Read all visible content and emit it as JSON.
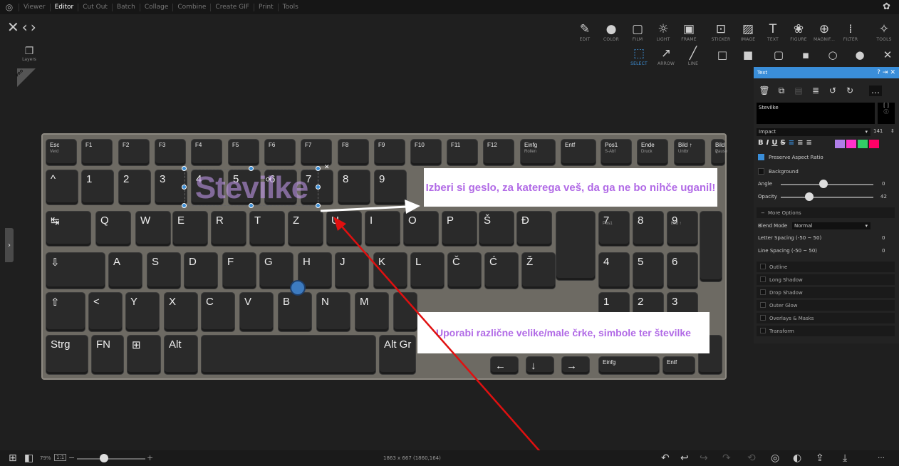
{
  "menu": {
    "items": [
      "Viewer",
      "Editor",
      "Cut Out",
      "Batch",
      "Collage",
      "Combine",
      "Create GIF",
      "Print",
      "Tools"
    ],
    "active_index": 1
  },
  "toolbar": {
    "tools": [
      {
        "label": "EDIT",
        "icon": "edit-icon"
      },
      {
        "label": "COLOR",
        "icon": "color-icon"
      },
      {
        "label": "FILM",
        "icon": "film-icon"
      },
      {
        "label": "LIGHT",
        "icon": "light-icon"
      },
      {
        "label": "FRAME",
        "icon": "frame-icon"
      },
      {
        "label": "STICKER",
        "icon": "sticker-icon"
      },
      {
        "label": "IMAGE",
        "icon": "image-icon"
      },
      {
        "label": "TEXT",
        "icon": "text-icon"
      },
      {
        "label": "FIGURE",
        "icon": "figure-icon"
      },
      {
        "label": "MAGNIF...",
        "icon": "magnifier-icon"
      },
      {
        "label": "FILTER",
        "icon": "filter-icon"
      },
      {
        "label": "TOOLS",
        "icon": "tools-icon"
      }
    ],
    "sub_tools": [
      {
        "label": "SELECT",
        "icon": "select-icon",
        "selected": true
      },
      {
        "label": "ARROW",
        "icon": "arrow-icon"
      },
      {
        "label": "LINE",
        "icon": "line-icon"
      }
    ]
  },
  "left": {
    "layers_label": "Layers",
    "pro_badge": "PRO"
  },
  "canvas": {
    "text_layer": "Stevilke",
    "banner_top": "Izberi si geslo, za katerega veš, da ga ne bo nihče uganil!",
    "banner_bottom": "Uporabi različne velike/male črke, simbole ter številke",
    "keys_row1": [
      "Esc",
      "F1",
      "F2",
      "F3",
      "F4",
      "F5",
      "F6",
      "F7",
      "F8",
      "F9",
      "F10",
      "F11",
      "F12",
      "Einfg",
      "Entf",
      "Pos1",
      "Ende",
      "Bild ↑",
      "Bild ↓"
    ],
    "keys_row1_sub": [
      "Verd",
      "",
      "",
      "",
      "",
      "",
      "",
      "",
      "",
      "",
      "",
      "",
      "",
      "Rollen",
      "",
      "S-Abf",
      "Druck",
      "Untbr",
      "Pause"
    ],
    "keys_row2": [
      "^",
      "1",
      "2",
      "3",
      "4",
      "5",
      "6",
      "7",
      "8",
      "9"
    ],
    "keys_row3": [
      "Q",
      "W",
      "E",
      "R",
      "T",
      "Z",
      "U",
      "I",
      "O",
      "P",
      "Š",
      "Đ"
    ],
    "keys_row3_num": [
      "7",
      "8",
      "9"
    ],
    "keys_row3_num_sub": [
      "Pos1",
      "↑",
      "Bild ↑"
    ],
    "keys_row4": [
      "A",
      "S",
      "D",
      "F",
      "G",
      "H",
      "J",
      "K",
      "L",
      "Č",
      "Ć",
      "Ž"
    ],
    "keys_row4_num": [
      "4",
      "5",
      "6"
    ],
    "keys_row5": [
      "Y",
      "X",
      "C",
      "V",
      "B",
      "N",
      "M"
    ],
    "keys_row5_num": [
      "1",
      "2",
      "3"
    ],
    "keys_row6": [
      "Strg",
      "FN",
      "Alt",
      "Alt Gr",
      "Einfg",
      "Entf"
    ]
  },
  "panel": {
    "title": "Text",
    "text_value": "Stevilke",
    "font": "Impact",
    "font_size": "141",
    "preserve_aspect": "Preserve Aspect Ratio",
    "background": "Background",
    "angle_label": "Angle",
    "angle_value": "0",
    "opacity_label": "Opacity",
    "opacity_value": "42",
    "more_options": "More Options",
    "blend_label": "Blend Mode",
    "blend_value": "Normal",
    "letter_spacing": "Letter Spacing (-50 ~ 50)",
    "letter_spacing_value": "0",
    "line_spacing": "Line Spacing (-50 ~ 50)",
    "line_spacing_value": "0",
    "sections": [
      "Outline",
      "Long Shadow",
      "Drop Shadow",
      "Outer Glow",
      "Overlays & Masks",
      "Transform"
    ],
    "colors": [
      "#b07ee8",
      "#ff33cc",
      "#33cc66",
      "#ff0066"
    ]
  },
  "bottom": {
    "zoom": "79%",
    "ratio": "1:1",
    "dimensions": "1863 x 667 (1860,164)"
  }
}
